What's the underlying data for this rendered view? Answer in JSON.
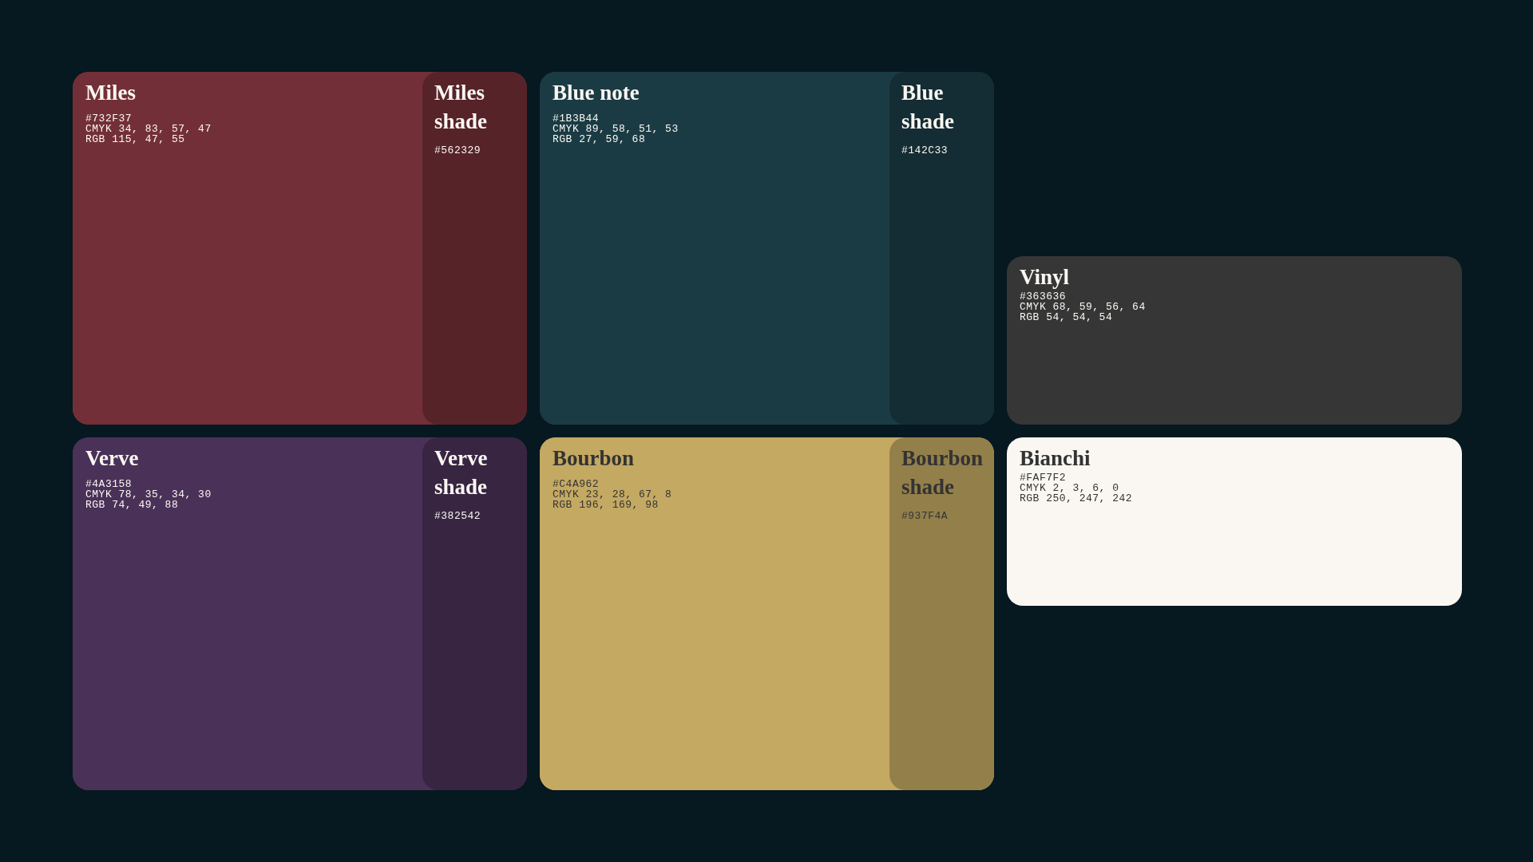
{
  "swatches": [
    {
      "name": "Miles",
      "color": "#732f37",
      "lines": [
        "#732F37",
        "CMYK 34, 83, 57, 47",
        "RGB 115, 47, 55"
      ],
      "shade": {
        "name": "Miles shade",
        "color": "#562329",
        "lines": [
          "#562329"
        ]
      }
    },
    {
      "name": "Blue note",
      "color": "#1b3b44",
      "lines": [
        "#1B3B44",
        "CMYK 89, 58, 51, 53",
        "RGB 27, 59, 68"
      ],
      "shade": {
        "name": "Blue shade",
        "color": "#142c33",
        "lines": [
          "#142C33"
        ]
      }
    },
    {
      "name": "Vinyl",
      "color": "#363636",
      "lines": [
        "#363636",
        "CMYK 68, 59, 56, 64",
        "RGB 54, 54, 54"
      ]
    },
    {
      "name": "Verve",
      "color": "#4a3158",
      "lines": [
        "#4A3158",
        "CMYK 78, 35, 34, 30",
        "RGB 74, 49, 88"
      ],
      "shade": {
        "name": "Verve shade",
        "color": "#382542",
        "lines": [
          "#382542"
        ]
      }
    },
    {
      "name": "Bourbon",
      "color": "#c4a962",
      "lines": [
        "#C4A962",
        "CMYK 23, 28, 67, 8",
        "RGB 196, 169, 98"
      ],
      "shade": {
        "name": "Bourbon shade",
        "color": "#937f4a",
        "lines": [
          "#937F4A"
        ]
      }
    },
    {
      "name": "Bianchi",
      "color": "#faf7f2",
      "lines": [
        "#FAF7F2",
        "CMYK 2, 3, 6, 0",
        "RGB 250, 247, 242"
      ]
    }
  ]
}
